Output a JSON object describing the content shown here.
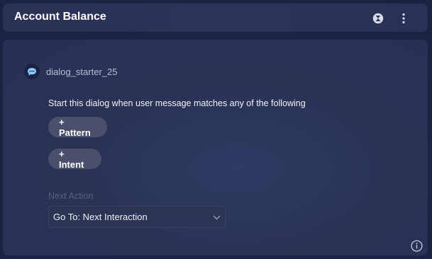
{
  "header": {
    "title": "Account Balance",
    "icons": [
      "collapse-hourglass-icon",
      "more-vertical-icon"
    ]
  },
  "node": {
    "name": "dialog_starter_25",
    "icon": "chat-bubble-icon"
  },
  "trigger": {
    "description": "Start this dialog when user message matches any of the following",
    "pattern_button": "+ Pattern",
    "intent_button": "+ Intent"
  },
  "next_action": {
    "label": "Next Action",
    "selected": "Go To: Next Interaction"
  },
  "footer": {
    "info_icon": "info-icon"
  },
  "colors": {
    "background": "#1c2342",
    "card": "#2a3256",
    "pill": "#4a506b",
    "node_icon_accent": "#8fc8ff"
  }
}
